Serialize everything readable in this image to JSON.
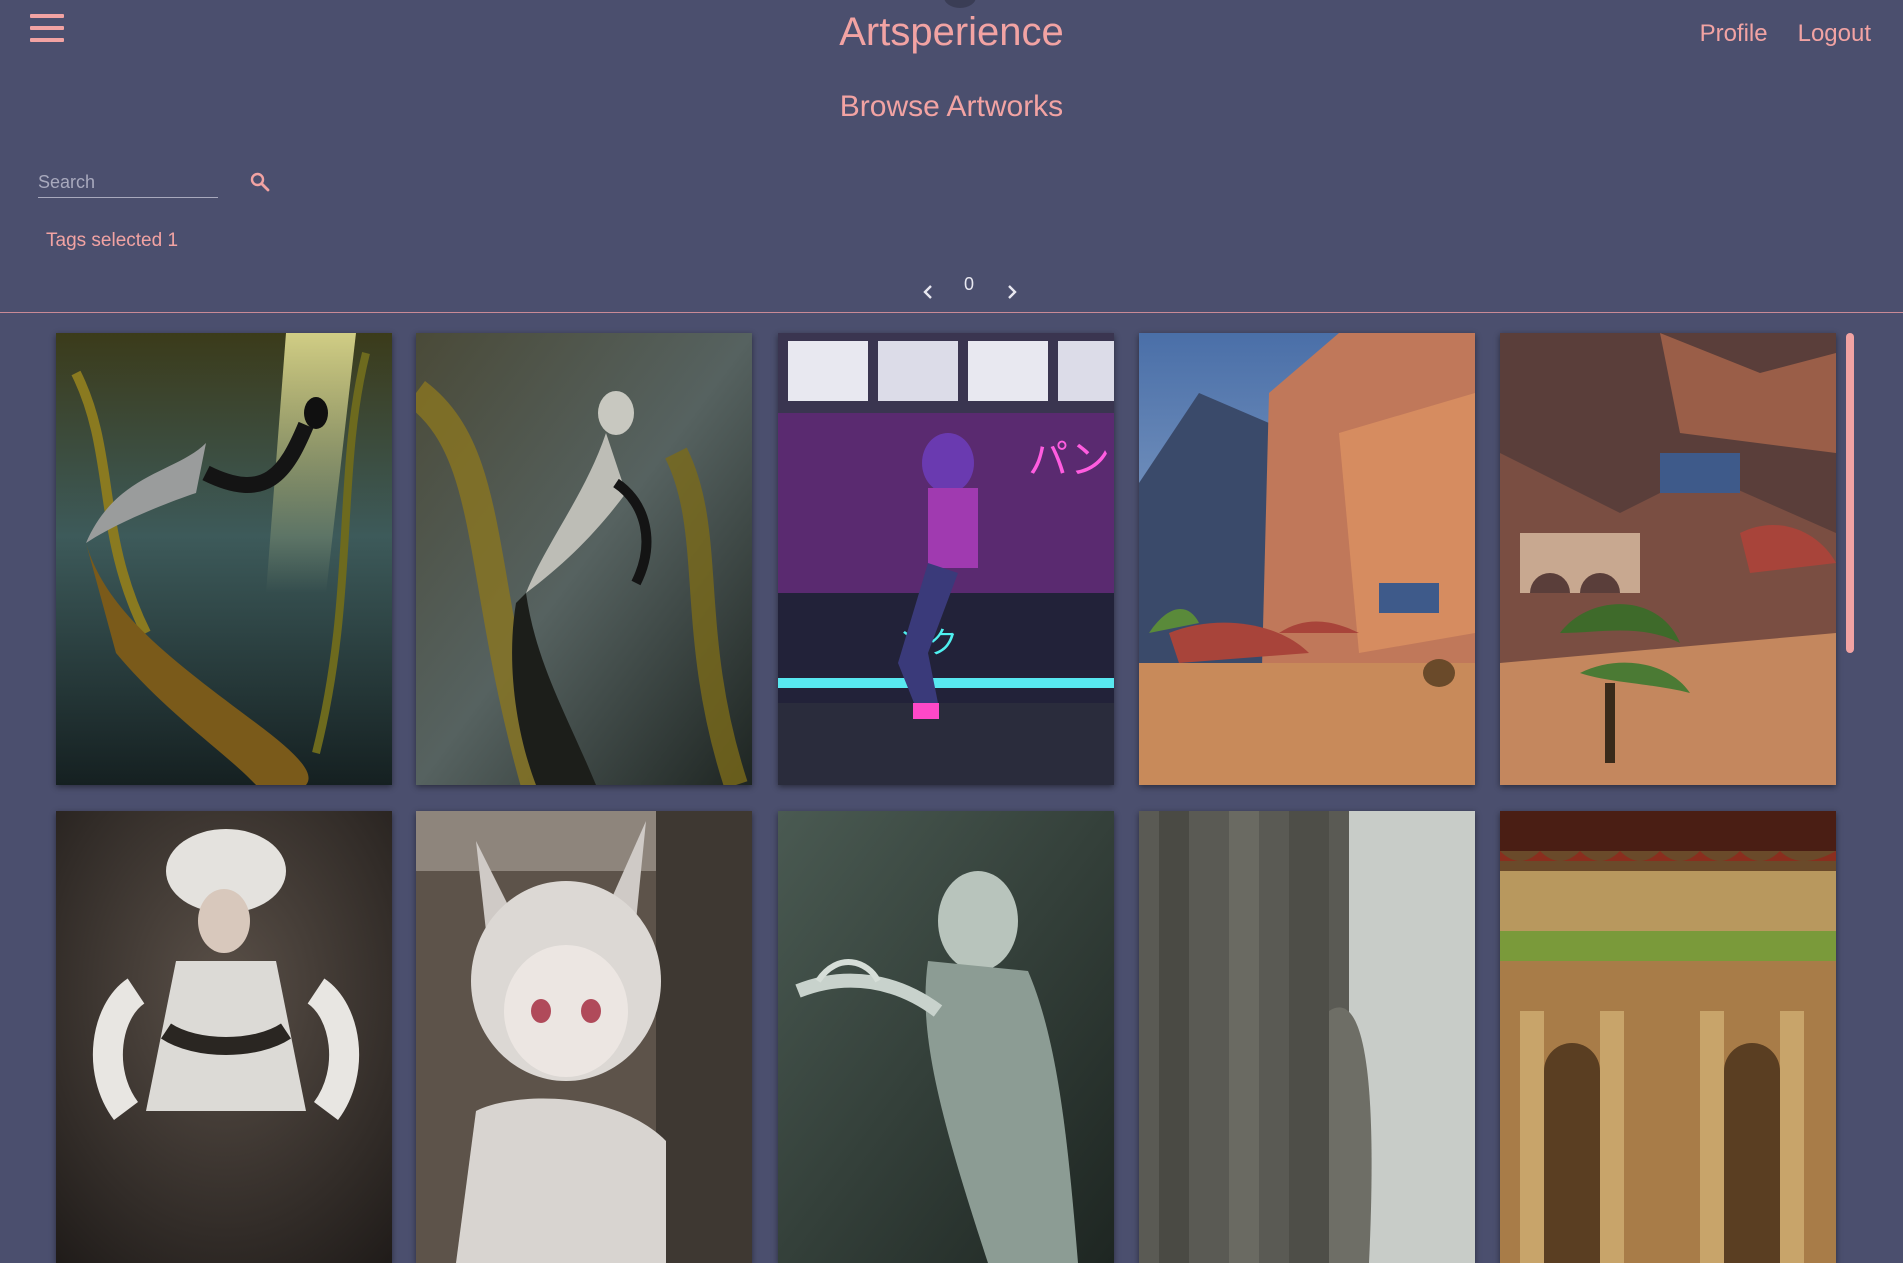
{
  "header": {
    "brand": "Artsperience",
    "menu_icon": "hamburger-menu-icon",
    "nav": [
      {
        "label": "Profile"
      },
      {
        "label": "Logout"
      }
    ]
  },
  "page": {
    "title": "Browse Artworks"
  },
  "search": {
    "placeholder": "Search",
    "value": "",
    "icon": "search-icon"
  },
  "tags": {
    "label": "Tags selected 1"
  },
  "pagination": {
    "current_page": "0",
    "prev_icon": "chevron-left-icon",
    "next_icon": "chevron-right-icon"
  },
  "artworks": [
    {
      "subject": "mermaid in kelp forest, light rays",
      "palette": [
        "#1e2a26",
        "#7a6a1c",
        "#c6c35a"
      ]
    },
    {
      "subject": "mermaid among golden kelp",
      "palette": [
        "#2a3330",
        "#6e5e22",
        "#a4a9a0"
      ]
    },
    {
      "subject": "cyberpunk girl sitting on neon boba counter",
      "palette": [
        "#1c1c33",
        "#b23bd1",
        "#40e0e0"
      ]
    },
    {
      "subject": "desert canyon village with red awnings",
      "palette": [
        "#3b4a73",
        "#c07b56",
        "#d9a56f"
      ]
    },
    {
      "subject": "desert ruins with caravan and palm trees",
      "palette": [
        "#4a3a3c",
        "#b8775a",
        "#4b6e3a"
      ]
    },
    {
      "subject": "portrait of woman in white headdress",
      "palette": [
        "#3a332d",
        "#d8d4d0",
        "#6a5c50"
      ]
    },
    {
      "subject": "silver-haired fox-eared anime girl",
      "palette": [
        "#5d534a",
        "#d6d2ce",
        "#a09890"
      ]
    },
    {
      "subject": "woman holding dragon pistol, monochrome green",
      "palette": [
        "#2e3b36",
        "#8c9b92",
        "#c8d2cc"
      ]
    },
    {
      "subject": "massive stone pillars in fog",
      "palette": [
        "#3a3b38",
        "#8b8d88",
        "#c4c8c4"
      ]
    },
    {
      "subject": "palace courtyard with arches and greenery",
      "palette": [
        "#4a2e1e",
        "#b8894e",
        "#7a9a3a"
      ]
    }
  ],
  "colors": {
    "background": "#4b4f6e",
    "accent": "#f2a3a3",
    "divider": "#c98a96"
  }
}
